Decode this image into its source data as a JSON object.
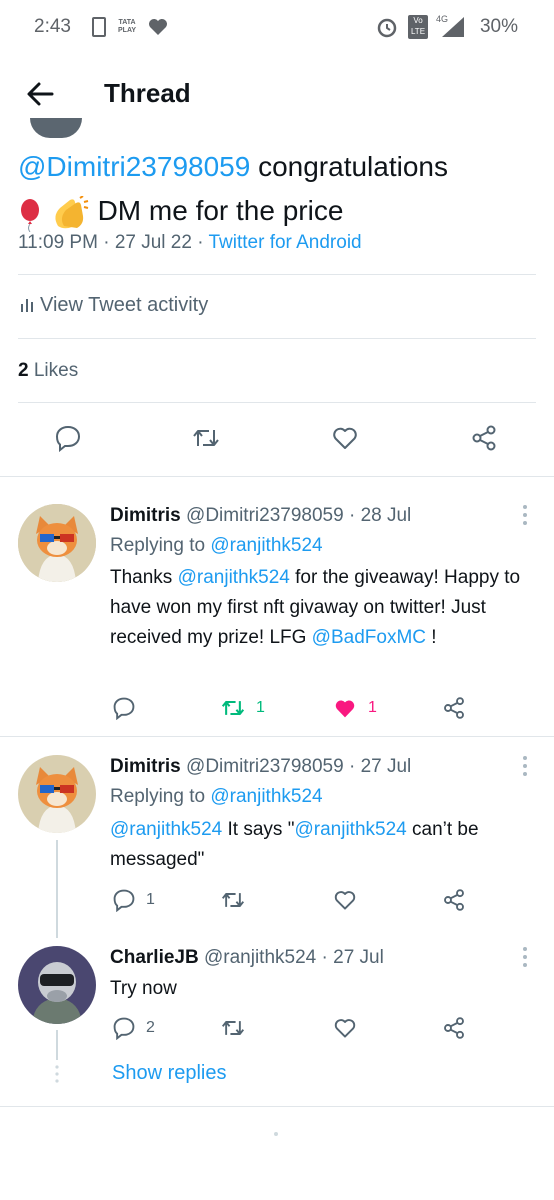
{
  "status_bar": {
    "time": "2:43",
    "carrier_label_top": "TATA",
    "carrier_label_bottom": "PLAY",
    "network": "4G",
    "volte": "Vo LTE",
    "battery": "30%"
  },
  "header": {
    "title": "Thread"
  },
  "main_tweet": {
    "mention": "@Dimitri23798059",
    "text_after_mention": " congratulations",
    "line2": "DM me for the price",
    "time": "11:09 PM",
    "date": "27 Jul 22",
    "source": "Twitter for Android",
    "activity_label": "View Tweet activity",
    "likes_count": "2",
    "likes_label": "Likes"
  },
  "replies": [
    {
      "name": "Dimitris",
      "handle": "@Dimitri23798059",
      "date": "28 Jul",
      "replying_prefix": "Replying to",
      "replying_to": "@ranjithk524",
      "text_a": "Thanks ",
      "mention_a": "@ranjithk524",
      "text_b": " for the giveaway! Happy to have won my first nft givaway on twitter! Just received my prize! LFG ",
      "mention_b": "@BadFoxMC",
      "text_c": " !",
      "retweets": "1",
      "likes": "1"
    },
    {
      "name": "Dimitris",
      "handle": "@Dimitri23798059",
      "date": "27 Jul",
      "replying_prefix": "Replying to",
      "replying_to": "@ranjithk524",
      "mention_a": "@ranjithk524",
      "text_a": " It says \"",
      "mention_b": "@ranjithk524",
      "text_b": " can’t be messaged\"",
      "replies": "1"
    },
    {
      "name": "CharlieJB",
      "handle": "@ranjithk524",
      "date": "27 Jul",
      "text": "Try now",
      "replies": "2"
    }
  ],
  "show_replies": "Show replies",
  "colors": {
    "accent": "#1d9bf0",
    "like": "#f91880",
    "retweet": "#00ba7c",
    "muted": "#536471"
  }
}
